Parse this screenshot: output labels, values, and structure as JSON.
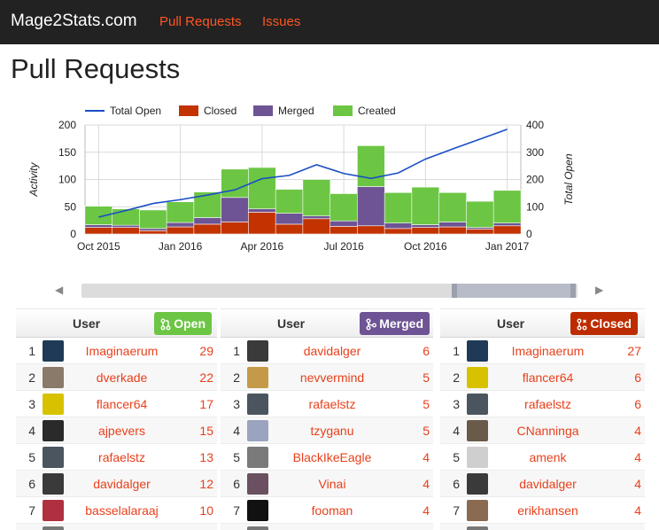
{
  "navbar": {
    "brand": "Mage2Stats.com",
    "links": [
      "Pull Requests",
      "Issues"
    ]
  },
  "page": {
    "title": "Pull Requests"
  },
  "chart_data": {
    "type": "bar",
    "stacked": true,
    "categories": [
      "Oct 2015",
      "Nov 2015",
      "Dec 2015",
      "Jan 2016",
      "Feb 2016",
      "Mar 2016",
      "Apr 2016",
      "May 2016",
      "Jun 2016",
      "Jul 2016",
      "Aug 2016",
      "Sep 2016",
      "Oct 2016",
      "Nov 2016",
      "Dec 2016",
      "Jan 2017"
    ],
    "x_tick_labels": [
      "Oct 2015",
      "Jan 2016",
      "Apr 2016",
      "Jul 2016",
      "Oct 2016",
      "Jan 2017"
    ],
    "series": [
      {
        "name": "Closed",
        "type": "bar",
        "color": "#c23300",
        "values": [
          12,
          12,
          6,
          13,
          18,
          22,
          40,
          18,
          28,
          14,
          15,
          10,
          12,
          13,
          9,
          15
        ]
      },
      {
        "name": "Merged",
        "type": "bar",
        "color": "#6e5494",
        "values": [
          5,
          4,
          4,
          8,
          12,
          45,
          6,
          20,
          5,
          10,
          72,
          10,
          5,
          9,
          3,
          5
        ]
      },
      {
        "name": "Created",
        "type": "bar",
        "color": "#6cc644",
        "values": [
          34,
          30,
          34,
          38,
          47,
          52,
          76,
          44,
          67,
          50,
          75,
          56,
          69,
          54,
          48,
          60
        ]
      },
      {
        "name": "Total Open",
        "type": "line",
        "color": "#1a4fc4",
        "axis": "right",
        "values": [
          62,
          86,
          112,
          126,
          143,
          162,
          203,
          215,
          254,
          222,
          204,
          224,
          275,
          312,
          348,
          384
        ]
      }
    ],
    "legend": [
      "Total Open",
      "Closed",
      "Merged",
      "Created"
    ],
    "legend_position": "top",
    "ylabel": "Activity",
    "ylabel_right": "Total Open",
    "ylim": [
      0,
      200
    ],
    "ylim_right": [
      0,
      400
    ],
    "yticks": [
      0,
      50,
      100,
      150,
      200
    ],
    "yticks_right": [
      0,
      100,
      200,
      300,
      400
    ],
    "grid": true
  },
  "tables": {
    "user_header": "User",
    "open": {
      "label": "Open",
      "rows": [
        {
          "rank": "1",
          "user": "Imaginaerum",
          "count": "29",
          "avatar": "#1e3a56"
        },
        {
          "rank": "2",
          "user": "dverkade",
          "count": "22",
          "avatar": "#8a7a6a"
        },
        {
          "rank": "3",
          "user": "flancer64",
          "count": "17",
          "avatar": "#d8c200"
        },
        {
          "rank": "4",
          "user": "ajpevers",
          "count": "15",
          "avatar": "#2a2a2a"
        },
        {
          "rank": "5",
          "user": "rafaelstz",
          "count": "13",
          "avatar": "#4a5560"
        },
        {
          "rank": "6",
          "user": "davidalger",
          "count": "12",
          "avatar": "#3a3a3a"
        },
        {
          "rank": "7",
          "user": "basselalaraaj",
          "count": "10",
          "avatar": "#b03040"
        },
        {
          "rank": "",
          "user": "",
          "count": "",
          "avatar": "#777777"
        }
      ]
    },
    "merged": {
      "label": "Merged",
      "rows": [
        {
          "rank": "1",
          "user": "davidalger",
          "count": "6",
          "avatar": "#3a3a3a"
        },
        {
          "rank": "2",
          "user": "nevvermind",
          "count": "5",
          "avatar": "#c49a48"
        },
        {
          "rank": "3",
          "user": "rafaelstz",
          "count": "5",
          "avatar": "#4a5560"
        },
        {
          "rank": "4",
          "user": "tzyganu",
          "count": "5",
          "avatar": "#9aa4c0"
        },
        {
          "rank": "5",
          "user": "BlackIkeEagle",
          "count": "4",
          "avatar": "#7a7a7a"
        },
        {
          "rank": "6",
          "user": "Vinai",
          "count": "4",
          "avatar": "#6a5060"
        },
        {
          "rank": "7",
          "user": "fooman",
          "count": "4",
          "avatar": "#111111"
        },
        {
          "rank": "",
          "user": "",
          "count": "",
          "avatar": "#777777"
        }
      ]
    },
    "closed": {
      "label": "Closed",
      "rows": [
        {
          "rank": "1",
          "user": "Imaginaerum",
          "count": "27",
          "avatar": "#1e3a56"
        },
        {
          "rank": "2",
          "user": "flancer64",
          "count": "6",
          "avatar": "#d8c200"
        },
        {
          "rank": "3",
          "user": "rafaelstz",
          "count": "6",
          "avatar": "#4a5560"
        },
        {
          "rank": "4",
          "user": "CNanninga",
          "count": "4",
          "avatar": "#6a5a4a"
        },
        {
          "rank": "5",
          "user": "amenk",
          "count": "4",
          "avatar": "#cfcfcf"
        },
        {
          "rank": "6",
          "user": "davidalger",
          "count": "4",
          "avatar": "#3a3a3a"
        },
        {
          "rank": "7",
          "user": "erikhansen",
          "count": "4",
          "avatar": "#8a6a50"
        },
        {
          "rank": "",
          "user": "",
          "count": "",
          "avatar": "#777777"
        }
      ]
    }
  }
}
